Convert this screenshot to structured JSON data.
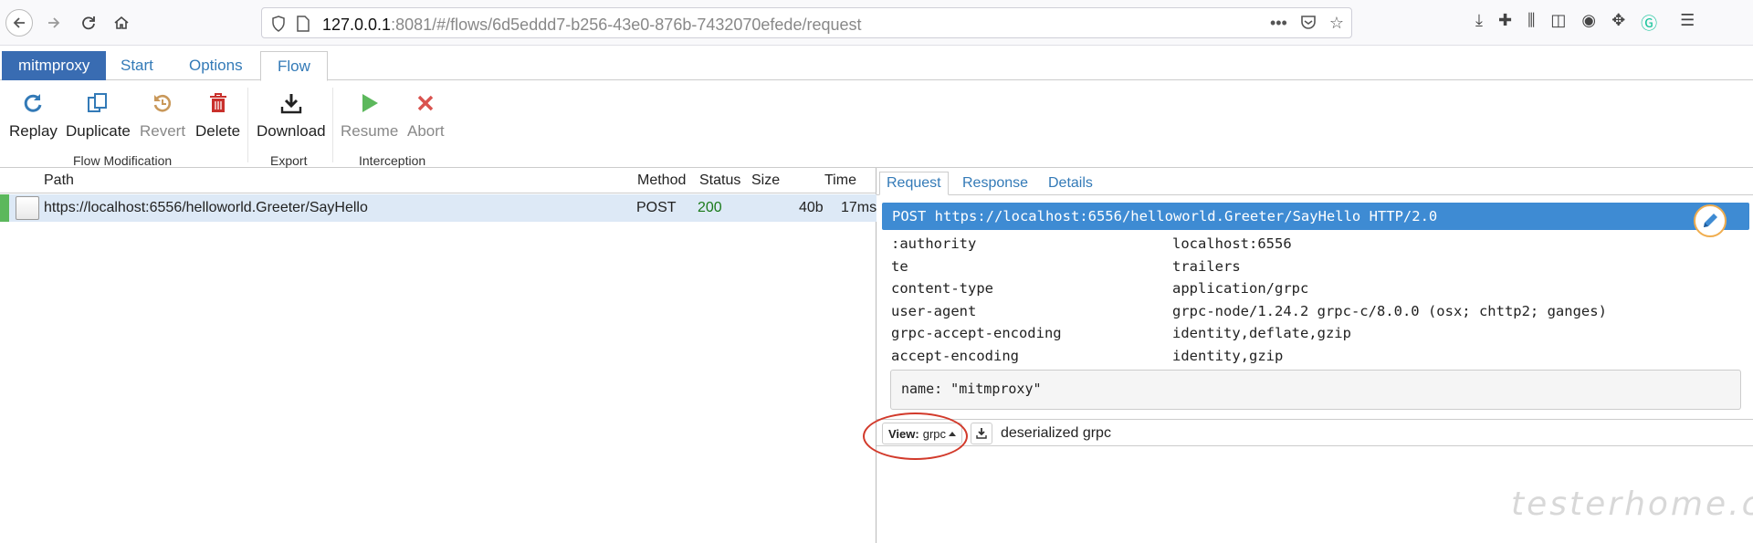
{
  "browser": {
    "url_host": "127.0.0.1",
    "url_rest": ":8081/#/flows/6d5eddd7-b256-43e0-876b-7432070efede/request"
  },
  "app_tabs": [
    {
      "label": "mitmproxy"
    },
    {
      "label": "Start"
    },
    {
      "label": "Options"
    },
    {
      "label": "Flow"
    }
  ],
  "ribbon": {
    "buttons": [
      {
        "label": "Replay",
        "icon": "replay-icon",
        "color": "#337ab7"
      },
      {
        "label": "Duplicate",
        "icon": "duplicate-icon",
        "color": "#337ab7"
      },
      {
        "label": "Revert",
        "icon": "revert-icon",
        "color": "#c9985a"
      },
      {
        "label": "Delete",
        "icon": "trash-icon",
        "color": "#c9302c"
      },
      {
        "label": "Download",
        "icon": "download-icon",
        "color": "#222"
      },
      {
        "label": "Resume",
        "icon": "play-icon",
        "color": "#5cb85c"
      },
      {
        "label": "Abort",
        "icon": "times-icon",
        "color": "#d9534f"
      }
    ],
    "groups": [
      "Flow Modification",
      "Export",
      "Interception"
    ]
  },
  "flow_table": {
    "columns": [
      "Path",
      "Method",
      "Status",
      "Size",
      "Time"
    ],
    "rows": [
      {
        "path": "https://localhost:6556/helloworld.Greeter/SayHello",
        "method": "POST",
        "status": "200",
        "size": "40b",
        "time": "17ms"
      }
    ]
  },
  "detail": {
    "tabs": [
      "Request",
      "Response",
      "Details"
    ],
    "request_line": "POST https://localhost:6556/helloworld.Greeter/SayHello HTTP/2.0",
    "headers": [
      {
        "name": ":authority",
        "value": "localhost:6556"
      },
      {
        "name": "te",
        "value": "trailers"
      },
      {
        "name": "content-type",
        "value": "application/grpc"
      },
      {
        "name": "user-agent",
        "value": "grpc-node/1.24.2 grpc-c/8.0.0 (osx; chttp2; ganges)"
      },
      {
        "name": "grpc-accept-encoding",
        "value": "identity,deflate,gzip"
      },
      {
        "name": "accept-encoding",
        "value": "identity,gzip"
      }
    ],
    "body": "name: \"mitmproxy\"",
    "view_label": "View:",
    "view_value": "grpc",
    "view_description": "deserialized grpc"
  },
  "watermark": "testerhome.com",
  "colors": {
    "brand": "#396cb2",
    "selected_row": "#dde9f6",
    "status_ok": "#1a7a1a",
    "request_line": "#3e8bd3",
    "annotation": "#d23a2b"
  }
}
